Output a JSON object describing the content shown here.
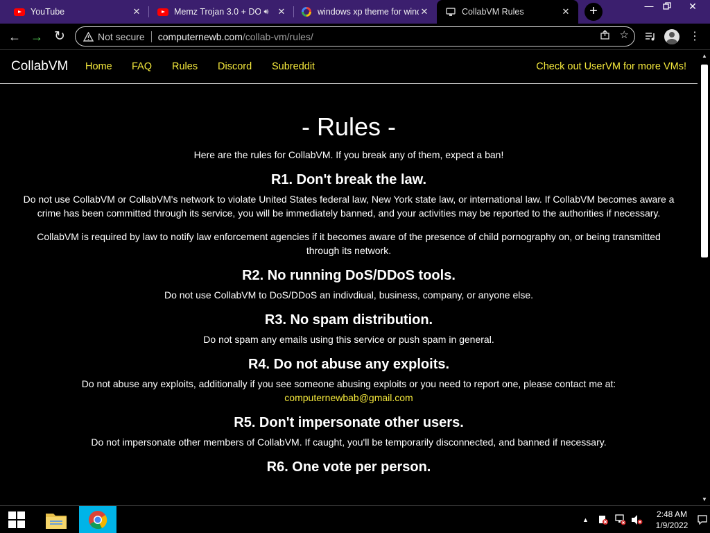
{
  "browser": {
    "tabs": [
      {
        "title": "YouTube",
        "favicon": "youtube-icon",
        "active": false
      },
      {
        "title": "Memz Trojan 3.0 + DO",
        "favicon": "youtube-icon",
        "active": false,
        "audio": true
      },
      {
        "title": "windows xp theme for wind",
        "favicon": "google-icon",
        "active": false
      },
      {
        "title": "CollabVM Rules",
        "favicon": "collabvm-icon",
        "active": true
      }
    ],
    "new_tab_label": "+",
    "security_label": "Not secure",
    "url_host": "computernewb.com",
    "url_path": "/collab-vm/rules/",
    "colors": {
      "tabstrip": "#3b1f6e",
      "accent_link": "#f5e93c",
      "background": "#000000"
    }
  },
  "site": {
    "brand": "CollabVM",
    "nav": [
      "Home",
      "FAQ",
      "Rules",
      "Discord",
      "Subreddit"
    ],
    "uservm_link": "Check out UserVM for more VMs!"
  },
  "content": {
    "title": "- Rules -",
    "intro": "Here are the rules for CollabVM. If you break any of them, expect a ban!",
    "rules": [
      {
        "heading": "R1. Don't break the law.",
        "paragraphs": [
          "Do not use CollabVM or CollabVM's network to violate United States federal law, New York state law, or international law. If CollabVM becomes aware a crime has been committed through its service, you will be immediately banned, and your activities may be reported to the authorities if necessary.",
          "CollabVM is required by law to notify law enforcement agencies if it becomes aware of the presence of child pornography on, or being transmitted through its network."
        ]
      },
      {
        "heading": "R2. No running DoS/DDoS tools.",
        "paragraphs": [
          "Do not use CollabVM to DoS/DDoS an indivdiual, business, company, or anyone else."
        ]
      },
      {
        "heading": "R3. No spam distribution.",
        "paragraphs": [
          "Do not spam any emails using this service or push spam in general."
        ]
      },
      {
        "heading": "R4. Do not abuse any exploits.",
        "paragraphs": [
          "Do not abuse any exploits, additionally if you see someone abusing exploits or you need to report one, please contact me at:"
        ],
        "email": "computernewbab@gmail.com"
      },
      {
        "heading": "R5. Don't impersonate other users.",
        "paragraphs": [
          "Do not impersonate other members of CollabVM. If caught, you'll be temporarily disconnected, and banned if necessary."
        ]
      },
      {
        "heading": "R6. One vote per person.",
        "paragraphs": []
      }
    ]
  },
  "taskbar": {
    "time": "2:48 AM",
    "date": "1/9/2022"
  }
}
